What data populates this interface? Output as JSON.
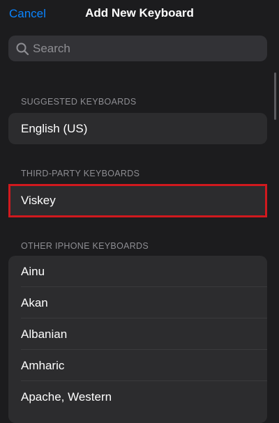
{
  "nav": {
    "cancel_label": "Cancel",
    "title": "Add New Keyboard"
  },
  "search": {
    "placeholder": "Search",
    "icon": "search-icon"
  },
  "sections": {
    "suggested": {
      "header": "SUGGESTED KEYBOARDS",
      "items": [
        "English (US)"
      ]
    },
    "third_party": {
      "header": "THIRD-PARTY KEYBOARDS",
      "items": [
        "Viskey"
      ]
    },
    "other": {
      "header": "OTHER IPHONE KEYBOARDS",
      "items": [
        "Ainu",
        "Akan",
        "Albanian",
        "Amharic",
        "Apache, Western"
      ]
    }
  },
  "colors": {
    "background": "#1c1c1e",
    "cell": "#2c2c2e",
    "accent": "#0a84ff",
    "highlight": "#d0191e",
    "secondary_text": "#8e8e93"
  }
}
